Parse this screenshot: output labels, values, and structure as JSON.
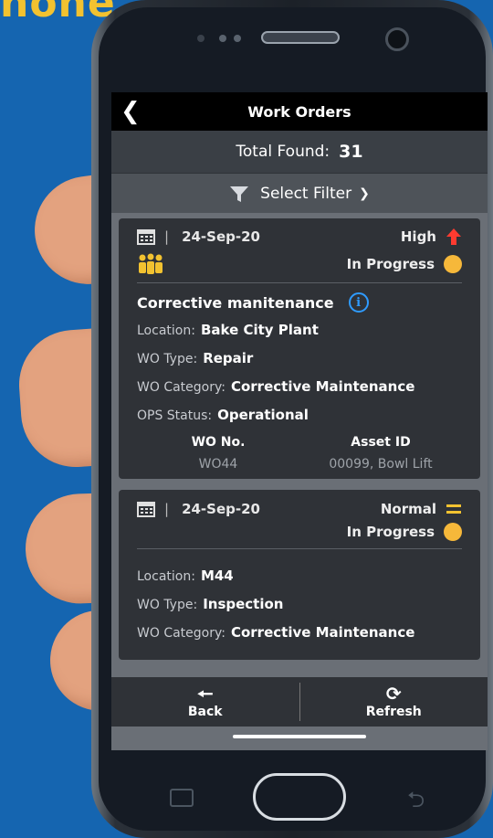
{
  "headline_fragment": "none,",
  "app": {
    "title": "Work Orders",
    "total_label": "Total Found:",
    "total_value": "31",
    "filter_label": "Select Filter"
  },
  "work_orders": [
    {
      "date": "24-Sep-20",
      "priority": "High",
      "priority_icon": "arrow-up-icon",
      "status": "In Progress",
      "subject": "Corrective manitenance",
      "location_label": "Location:",
      "location": "Bake City Plant",
      "type_label": "WO Type:",
      "type": "Repair",
      "category_label": "WO Category:",
      "category": "Corrective Maintenance",
      "ops_label": "OPS Status:",
      "ops": "Operational",
      "wo_no_label": "WO No.",
      "wo_no": "WO44",
      "asset_label": "Asset ID",
      "asset": "00099, Bowl Lift"
    },
    {
      "date": "24-Sep-20",
      "priority": "Normal",
      "priority_icon": "equals-icon",
      "status": "In Progress",
      "location_label": "Location:",
      "location": "M44",
      "type_label": "WO Type:",
      "type": "Inspection",
      "category_label": "WO Category:",
      "category": "Corrective Maintenance"
    }
  ],
  "bottom_bar": {
    "back_label": "Back",
    "refresh_label": "Refresh"
  },
  "colors": {
    "background": "#1565b0",
    "headline": "#f2c230",
    "status_dot": "#f6b83a",
    "high_arrow": "#ff3b30",
    "normal_equals": "#f2c230",
    "info_icon": "#2f9bff",
    "team_icon": "#f2c230"
  }
}
